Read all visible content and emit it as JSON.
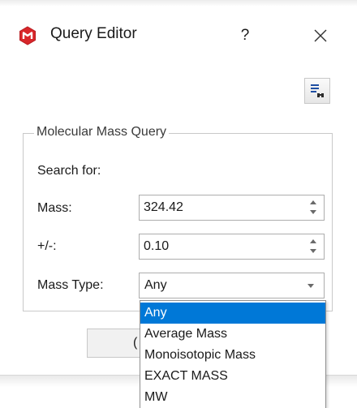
{
  "window": {
    "title": "Query Editor",
    "help_label": "?",
    "close_icon": "close-icon",
    "logo_icon": "app-logo-icon",
    "logo_color": "#d8262a"
  },
  "toolbar": {
    "find_icon": "list-search-icon"
  },
  "group": {
    "title": "Molecular Mass Query",
    "search_for_label": "Search for:",
    "mass_label": "Mass:",
    "mass_value": "324.42",
    "tolerance_label": "+/-:",
    "tolerance_value": "0.10",
    "mass_type_label": "Mass Type:",
    "mass_type_value": "Any"
  },
  "footer": {
    "button_partial_label": "("
  },
  "dropdown": {
    "selected_index": 0,
    "highlight_color": "#0078d7",
    "options": [
      "Any",
      "Average Mass",
      "Monoisotopic Mass",
      "EXACT MASS",
      "MW"
    ]
  }
}
